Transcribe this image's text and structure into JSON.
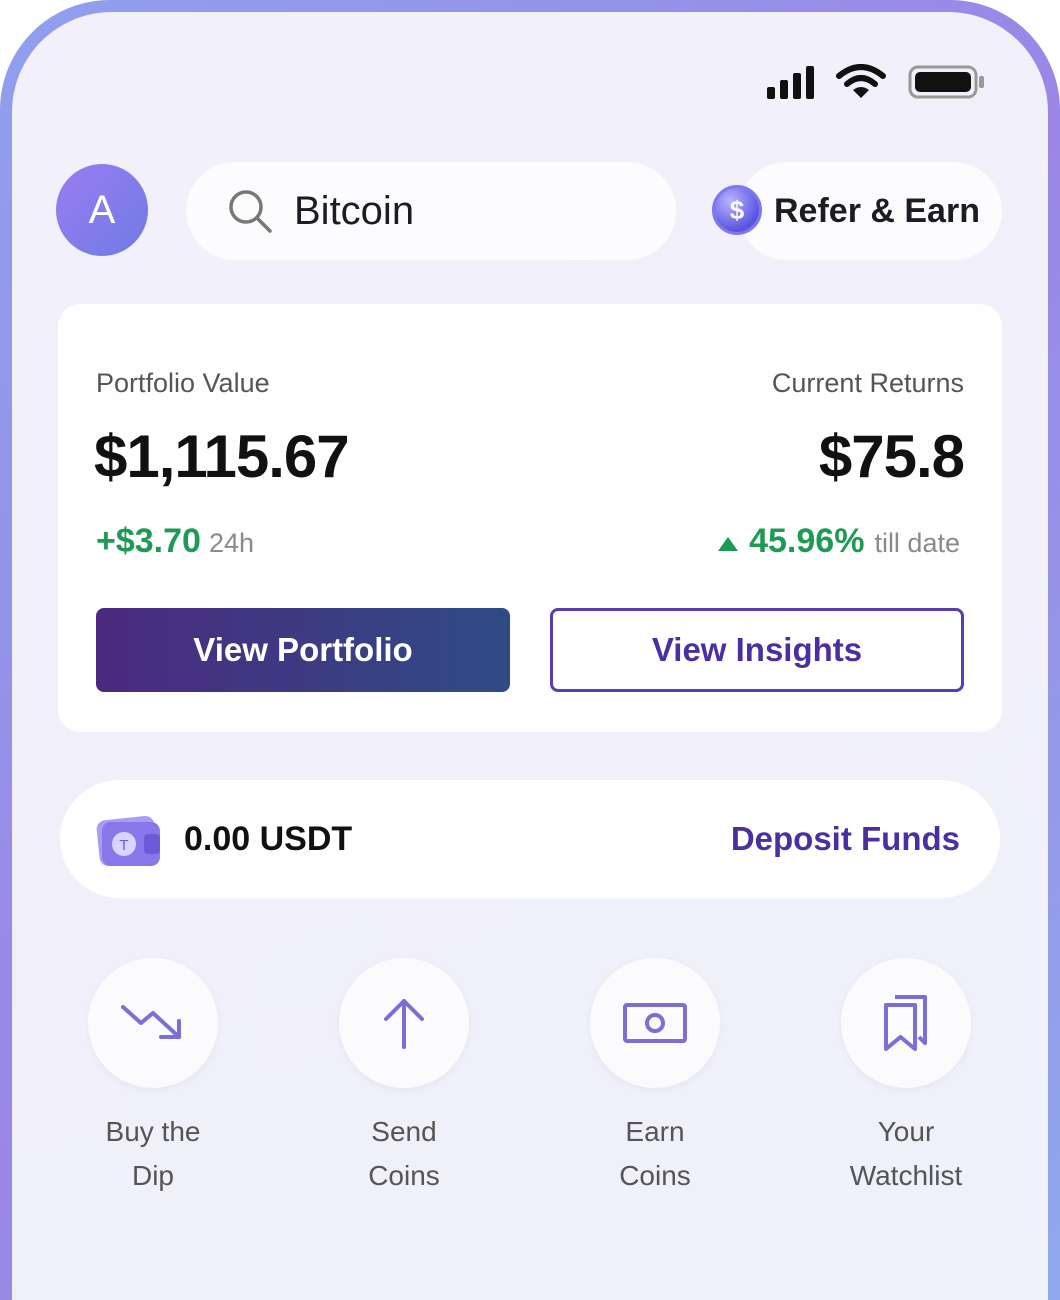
{
  "user": {
    "avatar_initial": "A"
  },
  "search": {
    "value": "Bitcoin"
  },
  "refer": {
    "label": "Refer & Earn",
    "coin_symbol": "$"
  },
  "portfolio": {
    "value_label": "Portfolio Value",
    "value": "$1,115.67",
    "change": "+$3.70",
    "change_period": "24h",
    "returns_label": "Current Returns",
    "returns_value": "$75.8",
    "returns_pct": "45.96%",
    "returns_period": "till date",
    "view_portfolio_label": "View Portfolio",
    "view_insights_label": "View Insights"
  },
  "wallet": {
    "amount": "0.00 USDT",
    "deposit_label": "Deposit Funds",
    "token_symbol": "T"
  },
  "actions": [
    {
      "line1": "Buy the",
      "line2": "Dip",
      "icon": "trending-down-icon"
    },
    {
      "line1": "Send",
      "line2": "Coins",
      "icon": "arrow-up-icon"
    },
    {
      "line1": "Earn",
      "line2": "Coins",
      "icon": "cash-icon"
    },
    {
      "line1": "Your",
      "line2": "Watchlist",
      "icon": "bookmarks-icon"
    }
  ],
  "colors": {
    "positive": "#1f9a55",
    "accent": "#4b2fa2",
    "icon": "#7b6fd6"
  }
}
